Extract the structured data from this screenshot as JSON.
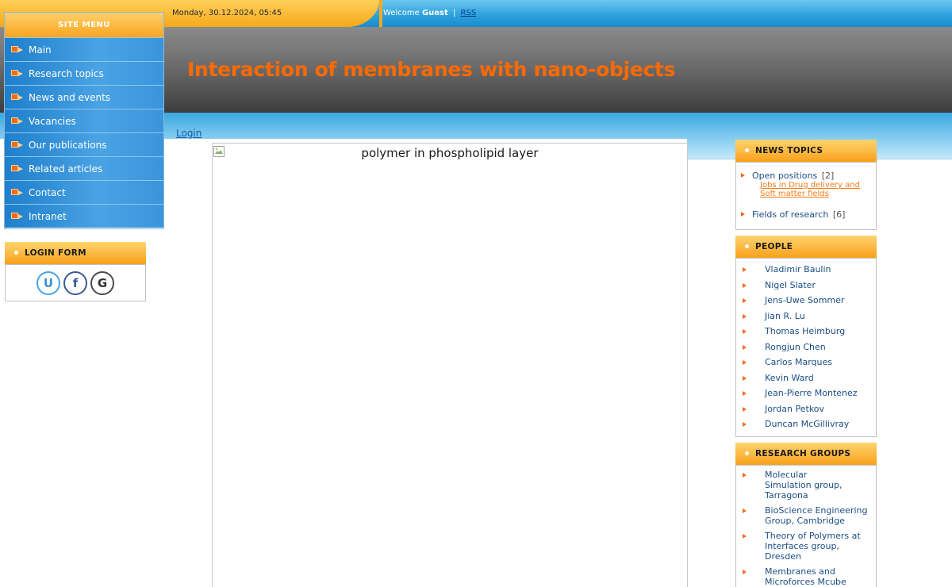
{
  "header": {
    "date": "Monday, 30.12.2024, 05:45",
    "welcome_prefix": "Welcome",
    "user": "Guest",
    "separator": "|",
    "rss": "RSS",
    "site_title": "Interaction of membranes with nano-objects",
    "login_link": "Login"
  },
  "menu": {
    "title": "SITE MENU",
    "items": [
      {
        "label": "Main"
      },
      {
        "label": "Research topics"
      },
      {
        "label": "News and events"
      },
      {
        "label": "Vacancies"
      },
      {
        "label": "Our publications"
      },
      {
        "label": "Related articles"
      },
      {
        "label": "Contact"
      },
      {
        "label": "Intranet"
      }
    ]
  },
  "login_form": {
    "title": "LOGIN FORM",
    "buttons": {
      "uid": "U",
      "facebook": "f",
      "google": "G"
    }
  },
  "main": {
    "image_alt": "polymer in phospholipid layer"
  },
  "news_topics": {
    "title": "NEWS TOPICS",
    "items": [
      {
        "label": "Open positions",
        "count": "[2]",
        "sub": "Jobs in Drug delivery and Soft matter fields"
      },
      {
        "label": "Fields of research",
        "count": "[6]",
        "sub": ""
      }
    ]
  },
  "people": {
    "title": "PEOPLE",
    "items": [
      "Vladimir Baulin",
      "Nigel Slater",
      "Jens-Uwe Sommer",
      "Jian R. Lu",
      "Thomas Heimburg",
      "Rongjun Chen",
      "Carlos Marques",
      "Kevin Ward",
      "Jean-Pierre Montenez",
      "Jordan Petkov",
      "Duncan McGillivray"
    ]
  },
  "research_groups": {
    "title": "RESEARCH GROUPS",
    "items": [
      "Molecular Simulation group, Tarragona",
      "BioScience Engineering Group, Cambridge",
      "Theory of Polymers at Interfaces group, Dresden",
      "Membranes and Microforces Mcube group, Strasbourg"
    ]
  },
  "colors": {
    "accent_orange": "#ff6a00",
    "menu_blue": "#1e7fcc",
    "header_orange": "#f9a51f",
    "link_blue": "#1b4d86"
  }
}
